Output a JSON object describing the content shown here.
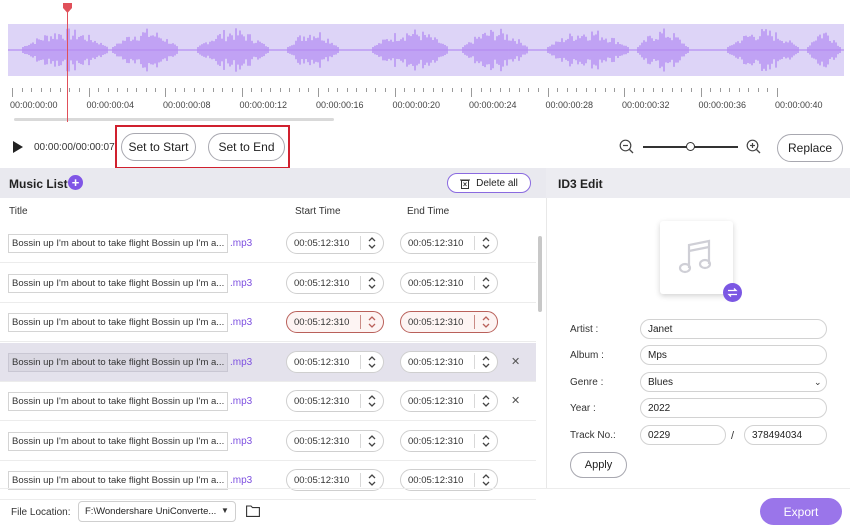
{
  "timeline": {
    "ticks": [
      "00:00:00:00",
      "00:00:00:04",
      "00:00:00:08",
      "00:00:00:12",
      "00:00:00:16",
      "00:00:00:20",
      "00:00:00:24",
      "00:00:00:28",
      "00:00:00:32",
      "00:00:00:36",
      "00:00:00:40"
    ],
    "waveform_color": "#b58df2",
    "waveform_bg": "#ddd4f7",
    "playhead_color": "#e0505a"
  },
  "controls": {
    "time": "00:00:00/00:00:07",
    "set_start_label": "Set to Start",
    "set_end_label": "Set to End",
    "replace_label": "Replace",
    "zoom_level": 0.45
  },
  "music_list": {
    "title": "Music List",
    "delete_all_label": "Delete all",
    "columns": {
      "title": "Title",
      "start": "Start Time",
      "end": "End Time"
    },
    "rows": [
      {
        "name": "Bossin up I'm about to take flight Bossin up I'm a...",
        "ext": ".mp3",
        "start": "00:05:12:310",
        "end": "00:05:12:310",
        "error": false,
        "selected": false,
        "closable": false
      },
      {
        "name": "Bossin up I'm about to take flight Bossin up I'm a...",
        "ext": ".mp3",
        "start": "00:05:12:310",
        "end": "00:05:12:310",
        "error": false,
        "selected": false,
        "closable": false
      },
      {
        "name": "Bossin up I'm about to take flight Bossin up I'm a...",
        "ext": ".mp3",
        "start": "00:05:12:310",
        "end": "00:05:12:310",
        "error": true,
        "selected": false,
        "closable": false
      },
      {
        "name": "Bossin up I'm about to take flight Bossin up I'm a...",
        "ext": ".mp3",
        "start": "00:05:12:310",
        "end": "00:05:12:310",
        "error": false,
        "selected": true,
        "closable": true
      },
      {
        "name": "Bossin up I'm about to take flight Bossin up I'm a...",
        "ext": ".mp3",
        "start": "00:05:12:310",
        "end": "00:05:12:310",
        "error": false,
        "selected": false,
        "closable": true
      },
      {
        "name": "Bossin up I'm about to take flight Bossin up I'm a...",
        "ext": ".mp3",
        "start": "00:05:12:310",
        "end": "00:05:12:310",
        "error": false,
        "selected": false,
        "closable": false
      },
      {
        "name": "Bossin up I'm about to take flight Bossin up I'm a...",
        "ext": ".mp3",
        "start": "00:05:12:310",
        "end": "00:05:12:310",
        "error": false,
        "selected": false,
        "closable": false
      }
    ]
  },
  "id3": {
    "title": "ID3 Edit",
    "artist_label": "Artist :",
    "artist": "Janet",
    "album_label": "Album :",
    "album": "Mps",
    "genre_label": "Genre :",
    "genre": "Blues",
    "year_label": "Year :",
    "year": "2022",
    "track_label": "Track No.:",
    "track": "0229",
    "track_total": "378494034",
    "track_sep": "/",
    "apply_label": "Apply"
  },
  "footer": {
    "file_location_label": "File Location:",
    "file_location": "F:\\Wondershare UniConverte...",
    "export_label": "Export"
  },
  "colors": {
    "accent": "#8055e6",
    "error": "#b9605a",
    "highlight": "#d0202e"
  }
}
